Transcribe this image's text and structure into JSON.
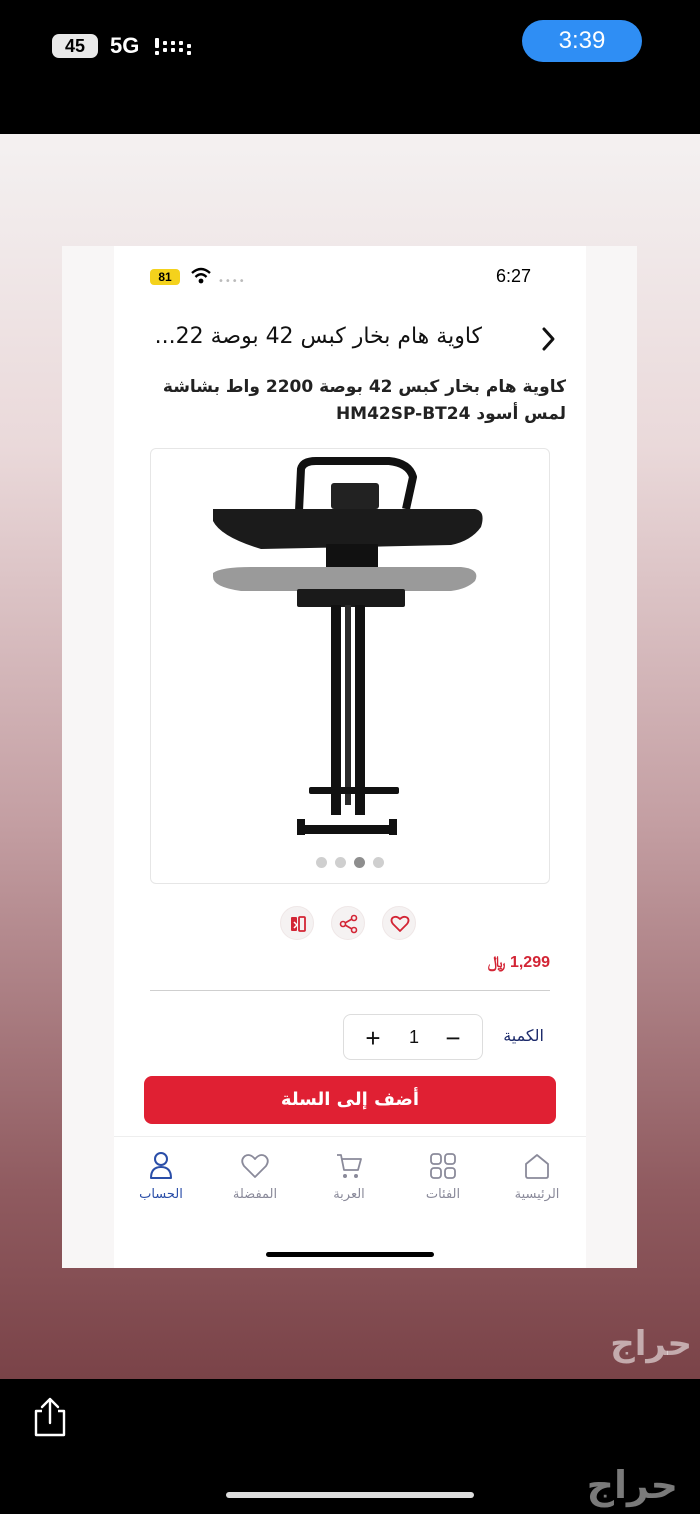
{
  "device": {
    "battery": "45",
    "network": "5G",
    "time": "3:39"
  },
  "inner_device": {
    "battery": "81",
    "time": "6:27"
  },
  "watermark": "حراج",
  "header": {
    "title": "كاوية هام بخار كبس 42 بوصة 22..."
  },
  "product": {
    "title": "كاوية هام بخار كبس 42 بوصة 2200 واط بشاشة لمس أسود HM42SP-BT24",
    "image_name": "steam-press-stand",
    "image_count": 4,
    "active_image": 3,
    "price": "1,299 ﷼"
  },
  "actions": {
    "compare_icon": "compare-icon",
    "share_icon": "share-icon",
    "favorite_icon": "heart-icon"
  },
  "quantity": {
    "label": "الكمية",
    "value": "1",
    "minus": "−",
    "plus": "+"
  },
  "cart_button": {
    "label": "أضف إلى السلة"
  },
  "tabbar": {
    "items": [
      {
        "label": "الرئيسية",
        "icon": "home-icon"
      },
      {
        "label": "الفئات",
        "icon": "categories-icon"
      },
      {
        "label": "العربة",
        "icon": "cart-icon"
      },
      {
        "label": "المفضلة",
        "icon": "heart-icon"
      },
      {
        "label": "الحساب",
        "icon": "account-icon",
        "active": true
      }
    ]
  },
  "colors": {
    "accent_red": "#e02033",
    "nav_blue": "#2a4ea8",
    "time_pill": "#2f8ef4"
  }
}
